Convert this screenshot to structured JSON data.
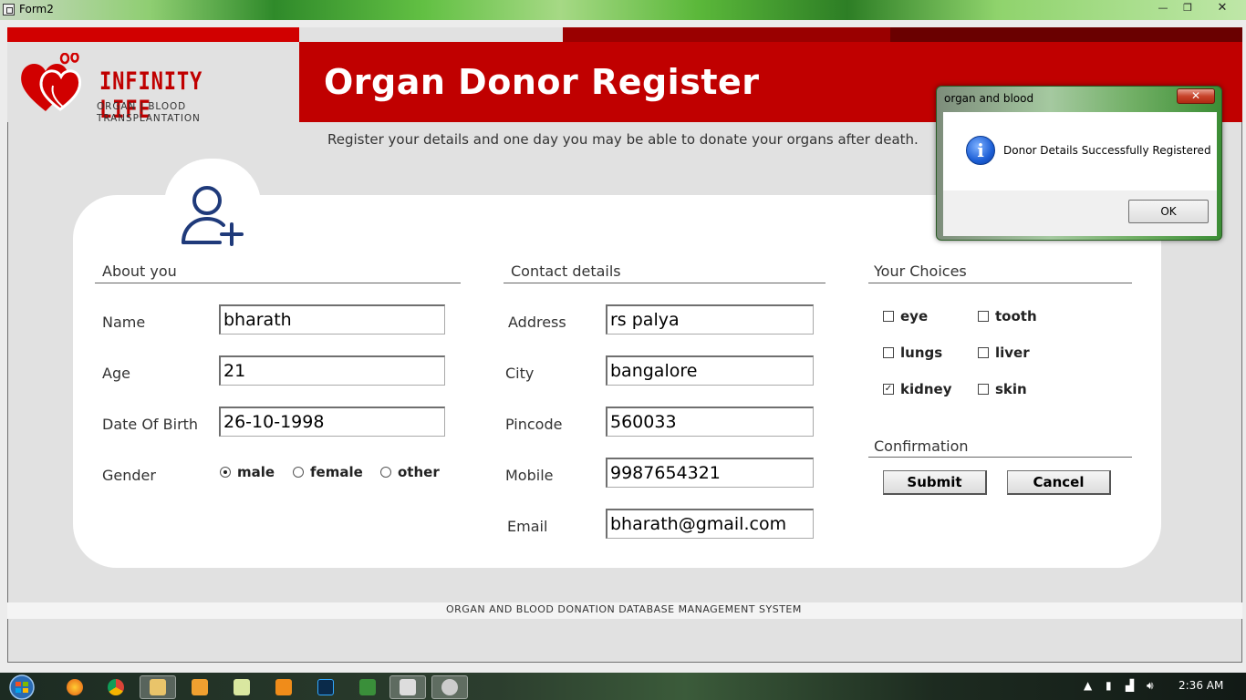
{
  "window": {
    "title": "Form2",
    "minimize": "—",
    "maximize": "❐",
    "close": "✕"
  },
  "header": {
    "logo_name": "INFINITY LIFE",
    "logo_tagline": "ORGAN | BLOOD TRANSPLANTATION",
    "heading": "Organ Donor Register",
    "subtitle": "Register your details and one day you may be able to donate your organs after death."
  },
  "about": {
    "title": "About you",
    "name_label": "Name",
    "name_value": "bharath",
    "age_label": "Age",
    "age_value": "21",
    "dob_label": "Date Of Birth",
    "dob_value": "26-10-1998",
    "gender_label": "Gender",
    "gender_options": [
      "male",
      "female",
      "other"
    ],
    "gender_selected": "male"
  },
  "contact": {
    "title": "Contact details",
    "address_label": "Address",
    "address_value": "rs palya",
    "city_label": "City",
    "city_value": "bangalore",
    "pincode_label": "Pincode",
    "pincode_value": "560033",
    "mobile_label": "Mobile",
    "mobile_value": "9987654321",
    "email_label": "Email",
    "email_value": "bharath@gmail.com"
  },
  "choices": {
    "title": "Your Choices",
    "items": [
      {
        "label": "eye",
        "checked": false
      },
      {
        "label": "tooth",
        "checked": false
      },
      {
        "label": "lungs",
        "checked": false
      },
      {
        "label": "liver",
        "checked": false
      },
      {
        "label": "kidney",
        "checked": true
      },
      {
        "label": "skin",
        "checked": false
      }
    ]
  },
  "confirmation": {
    "title": "Confirmation",
    "submit_label": "Submit",
    "cancel_label": "Cancel"
  },
  "footer": {
    "text": "ORGAN AND BLOOD DONATION DATABASE MANAGEMENT SYSTEM"
  },
  "message_box": {
    "title": "organ and blood",
    "icon": "info-icon",
    "message": "Donor Details Successfully Registered",
    "ok_label": "OK",
    "close": "✕"
  },
  "taskbar": {
    "clock": "2:36 AM",
    "apps": [
      "firefox",
      "chrome",
      "file-explorer",
      "media-player",
      "notepad",
      "sublime-text",
      "photoshop",
      "app-installer",
      "form-app",
      "app-window"
    ]
  },
  "colors": {
    "brand_red": "#c00000",
    "dark_red": "#6a0000",
    "card_bg": "#ffffff",
    "page_bg": "#e1e1e1"
  }
}
